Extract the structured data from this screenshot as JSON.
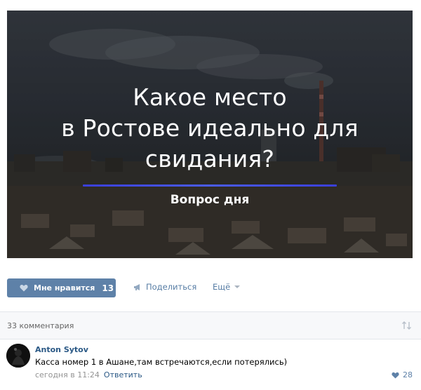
{
  "post": {
    "image": {
      "title_lines": [
        "Какое место",
        "в Ростове идеально для",
        "свидания?"
      ],
      "subtitle": "Вопрос дня"
    },
    "actions": {
      "like_label": "Мне нравится",
      "like_count": "13",
      "share_label": "Поделиться",
      "more_label": "Ещё"
    }
  },
  "comments": {
    "count_label": "33 комментария",
    "items": [
      {
        "author": "Anton Sytov",
        "text": "Касса номер 1 в Ашане,там встречаются,если потерялись)",
        "time": "сегодня в 11:24",
        "reply_label": "Ответить",
        "likes": "28"
      }
    ]
  },
  "colors": {
    "accent": "#5e81a8",
    "link": "#2a5885",
    "hero_line": "#4a5cf0"
  }
}
